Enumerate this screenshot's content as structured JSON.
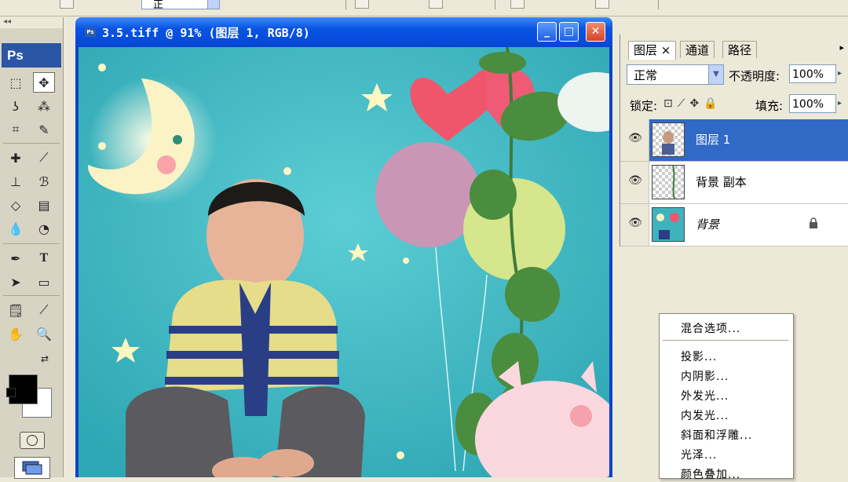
{
  "toolbar": {
    "blend_mode_short": "正"
  },
  "toolbox": {
    "logo": "Ps",
    "tools": [
      "marquee",
      "move",
      "lasso",
      "magic-wand",
      "crop",
      "slice",
      "healing-brush",
      "brush",
      "clone-stamp",
      "history-brush",
      "eraser",
      "gradient",
      "blur",
      "dodge",
      "pen",
      "type",
      "path-selection",
      "shape",
      "notes",
      "eyedropper",
      "hand",
      "zoom"
    ]
  },
  "document": {
    "title": "3.5.tiff @ 91% (图层 1, RGB/8)",
    "buttons": {
      "minimize": "_",
      "maximize": "□",
      "close": "✕"
    }
  },
  "layers_panel": {
    "tabs": [
      "图层",
      "通道",
      "路径"
    ],
    "active_tab_close": "×",
    "blend_mode": "正常",
    "opacity_label": "不透明度:",
    "opacity_value": "100%",
    "lock_label": "锁定:",
    "fill_label": "填充:",
    "fill_value": "100%",
    "layers": [
      {
        "name": "图层 1",
        "selected": true,
        "visible": true,
        "locked": false
      },
      {
        "name": "背景 副本",
        "selected": false,
        "visible": true,
        "locked": false
      },
      {
        "name": "背景",
        "selected": false,
        "visible": true,
        "locked": true
      }
    ]
  },
  "context_menu": {
    "items": [
      "混合选项...",
      "投影...",
      "内阴影...",
      "外发光...",
      "内发光...",
      "斜面和浮雕...",
      "光泽...",
      "颜色叠加..."
    ]
  },
  "colors": {
    "title_bar": "#0a54e3",
    "selected_layer": "#3169c6",
    "foreground": "#000000",
    "background": "#ffffff",
    "canvas_bg": "#4bbcc4"
  }
}
